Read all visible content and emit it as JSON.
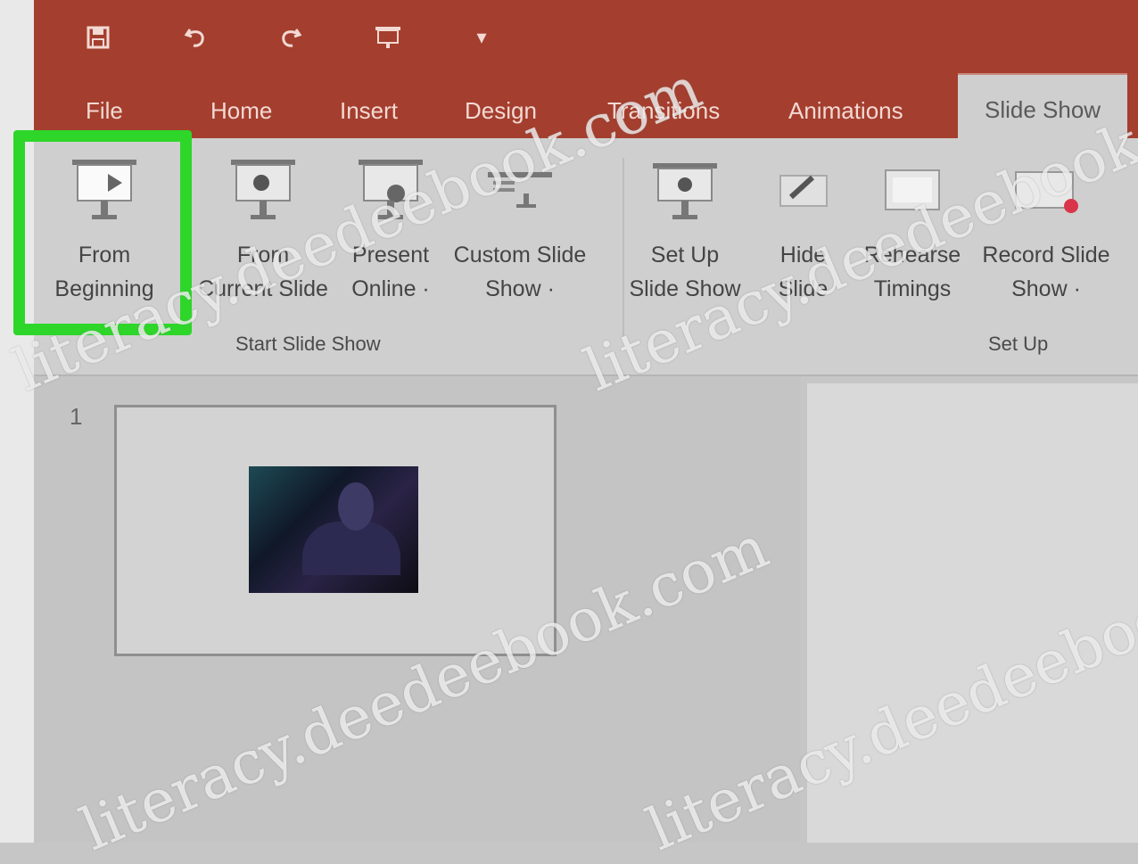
{
  "quick_access": {
    "items": [
      "save-icon",
      "undo-icon",
      "redo-icon",
      "start-from-beginning-icon",
      "customize-icon"
    ]
  },
  "tabs": [
    {
      "label": "File"
    },
    {
      "label": "Home"
    },
    {
      "label": "Insert"
    },
    {
      "label": "Design"
    },
    {
      "label": "Transitions"
    },
    {
      "label": "Animations"
    },
    {
      "label": "Slide Show",
      "active": true
    }
  ],
  "ribbon": {
    "from_beginning": {
      "line1": "From",
      "line2": "Beginning"
    },
    "from_current": {
      "line1": "From",
      "line2": "Current Slide"
    },
    "present_online": {
      "line1": "Present",
      "line2": "Online ·"
    },
    "custom_show": {
      "line1": "Custom Slide",
      "line2": "Show ·"
    },
    "setup_show": {
      "line1": "Set Up",
      "line2": "Slide Show"
    },
    "hide_slide": {
      "line1": "Hide",
      "line2": "Slide"
    },
    "rehearse": {
      "line1": "Rehearse",
      "line2": "Timings"
    },
    "record": {
      "line1": "Record Slide",
      "line2": "Show ·"
    },
    "group_start": "Start Slide Show",
    "group_setup": "Set Up"
  },
  "slides": [
    {
      "number": "1"
    }
  ],
  "watermark": "literacy.deedeebook.com",
  "colors": {
    "titlebar": "#a43e2e",
    "highlight": "#2ed62a",
    "ribbon": "#cfcfcf"
  }
}
